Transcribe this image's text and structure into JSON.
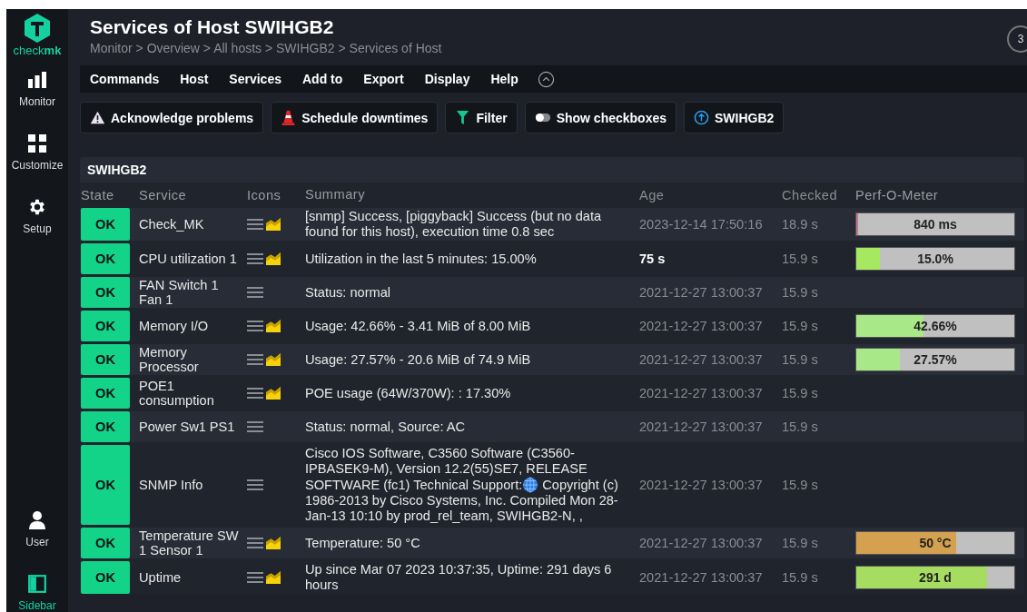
{
  "sidebar": {
    "logo_text": "check**mk**",
    "items": [
      {
        "label": "Monitor",
        "kind": "bars"
      },
      {
        "label": "Customize",
        "kind": "grid"
      },
      {
        "label": "Setup",
        "kind": "gear"
      }
    ],
    "bottom_items": [
      {
        "label": "User",
        "kind": "user"
      },
      {
        "label": "Sidebar",
        "kind": "panel"
      }
    ]
  },
  "header": {
    "title": "Services of Host SWIHGB2",
    "breadcrumb": "Monitor > Overview > All hosts > SWIHGB2 > Services of Host",
    "badge": "3"
  },
  "menu": [
    "Commands",
    "Host",
    "Services",
    "Add to",
    "Export",
    "Display",
    "Help"
  ],
  "actions": [
    {
      "label": "Acknowledge problems",
      "kind": "warning"
    },
    {
      "label": "Schedule downtimes",
      "kind": "cone"
    },
    {
      "label": "Filter",
      "kind": "filter"
    },
    {
      "label": "Show checkboxes",
      "kind": "toggle"
    },
    {
      "label": "SWIHGB2",
      "kind": "up"
    }
  ],
  "table": {
    "group": "SWIHGB2",
    "columns": [
      "State",
      "Service",
      "Icons",
      "Summary",
      "Age",
      "Checked",
      "Perf-O-Meter"
    ],
    "rows": [
      {
        "state": "OK",
        "service": "Check_MK",
        "graph": true,
        "summary": "[snmp] Success, [piggyback] Success (but no data found for this host), execution time 0.8 sec",
        "age": "2023-12-14 17:50:16",
        "age_recent": false,
        "checked": "18.9 s",
        "perf": {
          "label": "840 ms",
          "level": 0.01,
          "color": "#c07890"
        }
      },
      {
        "state": "OK",
        "service": "CPU utilization 1",
        "graph": true,
        "summary": "Utilization in the last 5 minutes: 15.00%",
        "age": "75 s",
        "age_recent": true,
        "checked": "15.9 s",
        "perf": {
          "label": "15.0%",
          "level": 0.15,
          "color": "#a6e85f"
        }
      },
      {
        "state": "OK",
        "service": "FAN Switch 1 Fan 1",
        "graph": false,
        "summary": "Status: normal",
        "age": "2021-12-27 13:00:37",
        "age_recent": false,
        "checked": "15.9 s"
      },
      {
        "state": "OK",
        "service": "Memory I/O",
        "graph": true,
        "summary": "Usage: 42.66% - 3.41 MiB of 8.00 MiB",
        "age": "2021-12-27 13:00:37",
        "age_recent": false,
        "checked": "15.9 s",
        "perf": {
          "label": "42.66%",
          "level": 0.4266,
          "color": "#a8e888"
        }
      },
      {
        "state": "OK",
        "service": "Memory Processor",
        "graph": true,
        "summary": "Usage: 27.57% - 20.6 MiB of 74.9 MiB",
        "age": "2021-12-27 13:00:37",
        "age_recent": false,
        "checked": "15.9 s",
        "perf": {
          "label": "27.57%",
          "level": 0.2757,
          "color": "#a8e888"
        }
      },
      {
        "state": "OK",
        "service": "POE1 consumption",
        "graph": true,
        "summary": "POE usage (64W/370W): : 17.30%",
        "age": "2021-12-27 13:00:37",
        "age_recent": false,
        "checked": "15.9 s"
      },
      {
        "state": "OK",
        "service": "Power Sw1 PS1",
        "graph": false,
        "summary": "Status: normal, Source: AC",
        "age": "2021-12-27 13:00:37",
        "age_recent": false,
        "checked": "15.9 s"
      },
      {
        "state": "OK",
        "service": "SNMP Info",
        "graph": false,
        "summary": "Cisco IOS Software, C3560 Software (C3560-IPBASEK9-M), Version 12.2(55)SE7, RELEASE SOFTWARE (fc1) Technical Support:",
        "summary_after_link": "Copyright (c) 1986-2013 by Cisco Systems, Inc. Compiled Mon 28-Jan-13 10:10 by prod_rel_team, SWIHGB2-N, ,",
        "age": "2021-12-27 13:00:37",
        "age_recent": false,
        "checked": "15.9 s"
      },
      {
        "state": "OK",
        "service": "Temperature SW 1 Sensor 1",
        "graph": true,
        "summary": "Temperature: 50 °C",
        "age": "2021-12-27 13:00:37",
        "age_recent": false,
        "checked": "15.9 s",
        "perf": {
          "label": "50 °C",
          "level": 0.63,
          "color": "#d4a150"
        }
      },
      {
        "state": "OK",
        "service": "Uptime",
        "graph": true,
        "summary": "Up since Mar 07 2023 10:37:35, Uptime: 291 days 6 hours",
        "age": "2021-12-27 13:00:37",
        "age_recent": false,
        "checked": "15.9 s",
        "perf": {
          "label": "291 d",
          "level": 0.83,
          "color": "#a6dd60"
        }
      }
    ]
  }
}
